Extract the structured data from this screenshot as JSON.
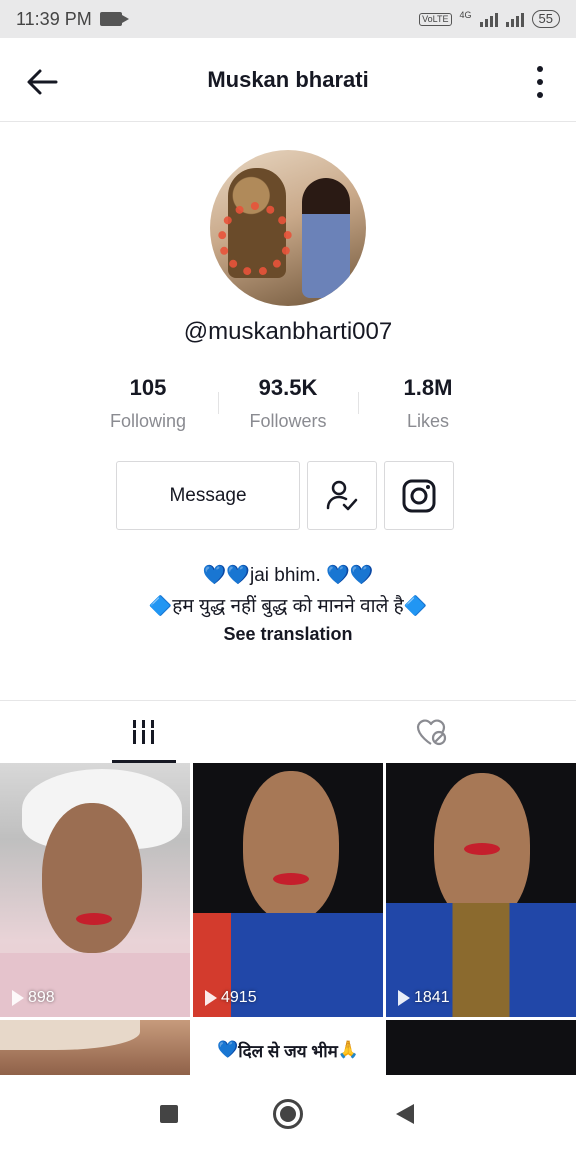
{
  "status_bar": {
    "time": "11:39 PM",
    "network_badge": "VoLTE",
    "network_type": "4G",
    "battery": "55"
  },
  "header": {
    "title": "Muskan bharati"
  },
  "profile": {
    "username": "@muskanbharti007",
    "stats": [
      {
        "value": "105",
        "label": "Following"
      },
      {
        "value": "93.5K",
        "label": "Followers"
      },
      {
        "value": "1.8M",
        "label": "Likes"
      }
    ],
    "message_button": "Message",
    "bio": {
      "line1_text": "jai bhim.",
      "line2_text": "हम युद्ध नहीं बुद्ध को मानने वाले है",
      "see_translation": "See translation"
    }
  },
  "tabs": [
    {
      "name": "videos",
      "icon": "grid-bars-icon",
      "active": true
    },
    {
      "name": "liked",
      "icon": "hidden-heart-icon",
      "active": false
    }
  ],
  "videos": [
    {
      "views": "898"
    },
    {
      "views": "4915"
    },
    {
      "views": "1841"
    },
    {
      "views": ""
    },
    {
      "caption": "दिल से जय भीम"
    },
    {
      "views": ""
    }
  ],
  "colors": {
    "text": "#161823",
    "secondary_text": "#8a8b91",
    "border": "#d9d9db",
    "status_bar_bg": "#e9e9ea",
    "heart_blue": "#1f7fe6"
  }
}
